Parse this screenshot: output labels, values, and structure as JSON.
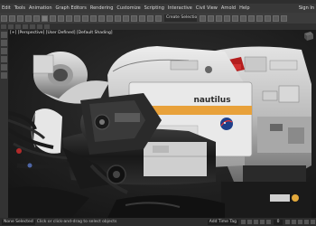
{
  "menu": {
    "items": [
      "Edit",
      "Tools",
      "Animation",
      "Graph Editors",
      "Rendering",
      "Customize",
      "Scripting",
      "Interactive",
      "Civil View",
      "Arnold",
      "Help"
    ],
    "login_label": "Sign In"
  },
  "toolbar": {
    "selection_set": "Create Selection Set"
  },
  "viewport": {
    "label": "[+] [Perspective] [User Defined] [Default Shading]",
    "ship_text": "nautilus"
  },
  "status": {
    "selected": "None Selected",
    "hint": "Click or click-and-drag to select objects",
    "add_time_tag": "Add Time Tag",
    "frame": "0"
  },
  "colors": {
    "accent_orange": "#e8a13a",
    "nasa_blue": "#1f3f8a",
    "viewport_bg": "#1c1c1c"
  }
}
